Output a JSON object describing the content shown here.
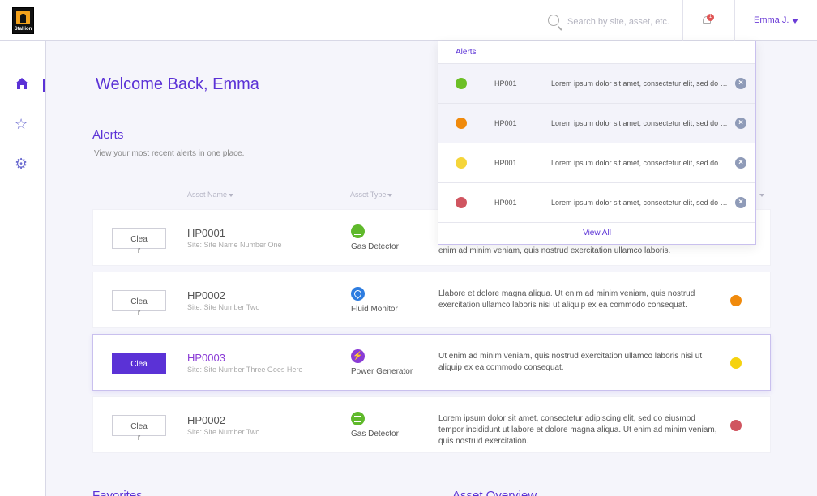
{
  "brand": {
    "logo_text": "Stallion"
  },
  "topbar": {
    "search_placeholder": "Search by site, asset, etc.",
    "notification_count": "1",
    "user_name": "Emma J."
  },
  "sidebar": {
    "items": [
      {
        "name": "home",
        "icon": "home-icon",
        "active": true
      },
      {
        "name": "favorites",
        "icon": "star-icon",
        "active": false
      },
      {
        "name": "settings",
        "icon": "gear-icon",
        "active": false
      }
    ]
  },
  "main": {
    "welcome": "Welcome Back, Emma",
    "alerts_title": "Alerts",
    "alerts_subtitle": "View your most recent alerts in one place.",
    "columns": [
      "Asset Name",
      "Asset Type"
    ],
    "clear_label": "Clear",
    "rows": [
      {
        "asset": "HP0001",
        "site": "Site: Site Name Number One",
        "type": "Gas Detector",
        "type_icon": "gas-detector-icon",
        "desc": "enim ad minim veniam, quis nostrud exercitation ullamco laboris.",
        "severity_color": ""
      },
      {
        "asset": "HP0002",
        "site": "Site: Site Number Two",
        "type": "Fluid Monitor",
        "type_icon": "fluid-monitor-icon",
        "desc": "Llabore et dolore magna aliqua. Ut enim ad minim veniam, quis nostrud exercitation ullamco laboris nisi ut aliquip ex ea commodo consequat.",
        "severity_color": "#f08a0c"
      },
      {
        "asset": "HP0003",
        "site": "Site: Site Number Three Goes Here",
        "type": "Power Generator",
        "type_icon": "power-generator-icon",
        "desc": "Ut enim ad minim veniam, quis nostrud exercitation ullamco laboris nisi ut aliquip ex ea commodo consequat.",
        "severity_color": "#f5d20f",
        "selected": true
      },
      {
        "asset": "HP0002",
        "site": "Site: Site Number Two",
        "type": "Gas Detector",
        "type_icon": "gas-detector-icon",
        "desc": "Lorem ipsum dolor sit amet, consectetur adipiscing elit, sed do eiusmod tempor incididunt ut labore et dolore magna aliqua. Ut enim ad minim veniam, quis nostrud exercitation.",
        "severity_color": "#d05560"
      }
    ],
    "favorites_title": "Favorites",
    "overview_title": "Asset Overview"
  },
  "dropdown": {
    "title": "Alerts",
    "items": [
      {
        "color": "#6cbf26",
        "id": "HP001",
        "msg": "Lorem ipsum dolor sit amet, consectetur elit, sed do eiusmod"
      },
      {
        "color": "#f08a0c",
        "id": "HP001",
        "msg": "Lorem ipsum dolor sit amet, consectetur elit, sed do eiusmod"
      },
      {
        "color": "#f5d53a",
        "id": "HP001",
        "msg": "Lorem ipsum dolor sit amet, consectetur elit, sed do eiusmod"
      },
      {
        "color": "#d05560",
        "id": "HP001",
        "msg": "Lorem ipsum dolor sit amet, consectetur elit, sed do eiusmod"
      }
    ],
    "view_all": "View All"
  }
}
